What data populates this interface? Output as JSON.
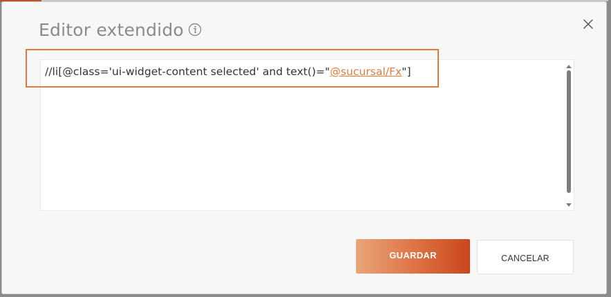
{
  "dialog": {
    "title": "Editor extendido",
    "info_icon": "info-icon",
    "close_icon": "close-icon"
  },
  "editor": {
    "value_prefix": "//li[@class='ui-widget-content selected' and text()=\"",
    "value_variable": "@sucursal/Fx",
    "value_suffix": "\"]"
  },
  "actions": {
    "save_label": "GUARDAR",
    "cancel_label": "CANCELAR"
  },
  "colors": {
    "accent": "#e07b3c",
    "highlight_border": "#e07b3c",
    "button_gradient_start": "#e8a57a",
    "button_gradient_end": "#c9461d"
  }
}
